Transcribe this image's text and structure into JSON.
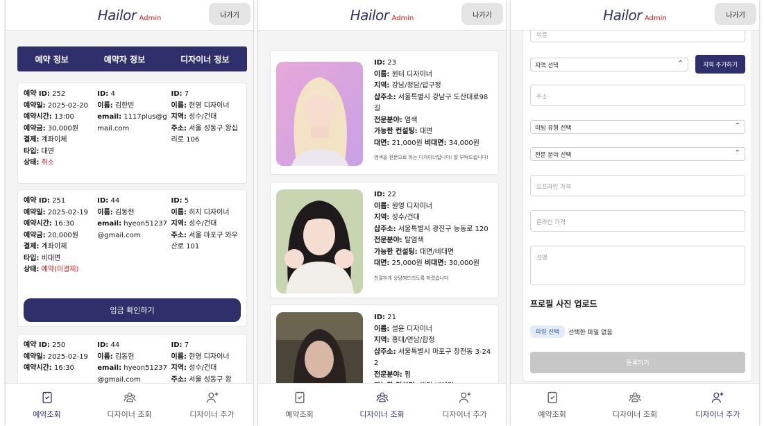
{
  "app": {
    "logo": "Hailor",
    "logo_badge": "Admin",
    "exit_label": "나가기"
  },
  "nav": [
    {
      "label": "예약조회",
      "icon": "calendar-check-icon"
    },
    {
      "label": "디자이너 조회",
      "icon": "users-icon"
    },
    {
      "label": "디자이너 추가",
      "icon": "user-plus-icon"
    }
  ],
  "colors": {
    "brand": "#2e2f6b",
    "accent_red": "#d21c1c",
    "disabled": "#c7c7c7"
  },
  "reservations": {
    "tabs": [
      "예약 정보",
      "예약자 정보",
      "디자이너 정보"
    ],
    "deposit_button": "입금 확인하기",
    "items": [
      {
        "res": [
          [
            "예약 ID:",
            "252"
          ],
          [
            "예약일:",
            "2025-02-20"
          ],
          [
            "예약시간:",
            "13:00"
          ],
          [
            "예약금:",
            "30,000원"
          ],
          [
            "결제:",
            "계좌이체"
          ],
          [
            "타입:",
            "대면"
          ],
          [
            "상태:",
            "취소"
          ]
        ],
        "cust": [
          [
            "ID:",
            "4"
          ],
          [
            "이름:",
            "김한빈"
          ],
          [
            "email:",
            "1117plus@gmail.com"
          ]
        ],
        "des": [
          [
            "ID:",
            "7"
          ],
          [
            "이름:",
            "현영 디자이너"
          ],
          [
            "지역:",
            "성수/건대"
          ],
          [
            "주소:",
            "서울 성동구 왕십리로 106"
          ]
        ]
      },
      {
        "res": [
          [
            "예약 ID:",
            "251"
          ],
          [
            "예약일:",
            "2025-02-19"
          ],
          [
            "예약시간:",
            "16:30"
          ],
          [
            "예약금:",
            "20,000원"
          ],
          [
            "결제:",
            "계좌이체"
          ],
          [
            "타입:",
            "비대면"
          ],
          [
            "상태:",
            "예약(미결제)"
          ]
        ],
        "cust": [
          [
            "ID:",
            "44"
          ],
          [
            "이름:",
            "김동현"
          ],
          [
            "email:",
            "hyeon51237@gmail.com"
          ]
        ],
        "des": [
          [
            "ID:",
            "5"
          ],
          [
            "이름:",
            "히지 디자이너"
          ],
          [
            "지역:",
            "성수/건대"
          ],
          [
            "주소:",
            "서울 마포구 와우산로 101"
          ]
        ]
      },
      {
        "res": [
          [
            "예약 ID:",
            "250"
          ],
          [
            "예약일:",
            "2025-02-19"
          ],
          [
            "예약시간:",
            "16:30"
          ]
        ],
        "cust": [
          [
            "ID:",
            "44"
          ],
          [
            "이름:",
            "김동현"
          ],
          [
            "email:",
            "hyeon51237@gmail.com"
          ]
        ],
        "des": [
          [
            "ID:",
            "7"
          ],
          [
            "이름:",
            "현영 디자이너"
          ],
          [
            "지역:",
            "성수/건대"
          ],
          [
            "주소:",
            "서울 성동구 왕"
          ]
        ]
      }
    ]
  },
  "designers": [
    {
      "fields": [
        [
          "ID:",
          "23"
        ],
        [
          "이름:",
          "윈터 디자이너"
        ],
        [
          "지역:",
          "강남/청담/압구정"
        ],
        [
          "샵주소:",
          "서울특별시 강남구 도산대로98길"
        ],
        [
          "전문분야:",
          "염색"
        ],
        [
          "가능한 컨설팅:",
          "대면"
        ]
      ],
      "price_offline_label": "대면:",
      "price_offline": "21,000원",
      "price_online_label": "비대면:",
      "price_online": "34,000원",
      "desc": "염색을 전문으로 하는 디자이너입니다! 잘 부탁드립니다!"
    },
    {
      "fields": [
        [
          "ID:",
          "22"
        ],
        [
          "이름:",
          "원영 디자이너"
        ],
        [
          "지역:",
          "성수/건대"
        ],
        [
          "샵주소:",
          "서울특별시 광진구 능동로 120"
        ],
        [
          "전문분야:",
          "탈염색"
        ],
        [
          "가능한 컨설팅:",
          "대면/비대면"
        ]
      ],
      "price_offline_label": "대면:",
      "price_offline": "25,000원",
      "price_online_label": "비대면:",
      "price_online": "30,000원",
      "desc": "친절하게 상담해드리도록 하겠습니다"
    },
    {
      "fields": [
        [
          "ID:",
          "21"
        ],
        [
          "이름:",
          "설윤 디자이너"
        ],
        [
          "지역:",
          "홍대/연남/합정"
        ],
        [
          "샵주소:",
          "서울특별시 마포구 창전동 3-242"
        ],
        [
          "전문분야:",
          "펌"
        ],
        [
          "가능한 컨설팅:",
          "대면/비대면"
        ]
      ],
      "price_offline_label": "",
      "price_offline": "",
      "price_online_label": "",
      "price_online": "",
      "desc": ""
    }
  ],
  "add_form": {
    "name_placeholder": "이름",
    "region_select": "지역 선택",
    "add_region_button": "지역 추가하기",
    "address_placeholder": "주소",
    "meeting_select": "미팅 유형 선택",
    "specialty_select": "전문 분야 선택",
    "offline_price_placeholder": "오프라인 가격",
    "online_price_placeholder": "온라인 가격",
    "description_placeholder": "설명",
    "upload_title": "프로필 사진 업로드",
    "file_button": "파일 선택",
    "file_status": "선택한 파일 없음",
    "submit_button": "등록하기"
  }
}
